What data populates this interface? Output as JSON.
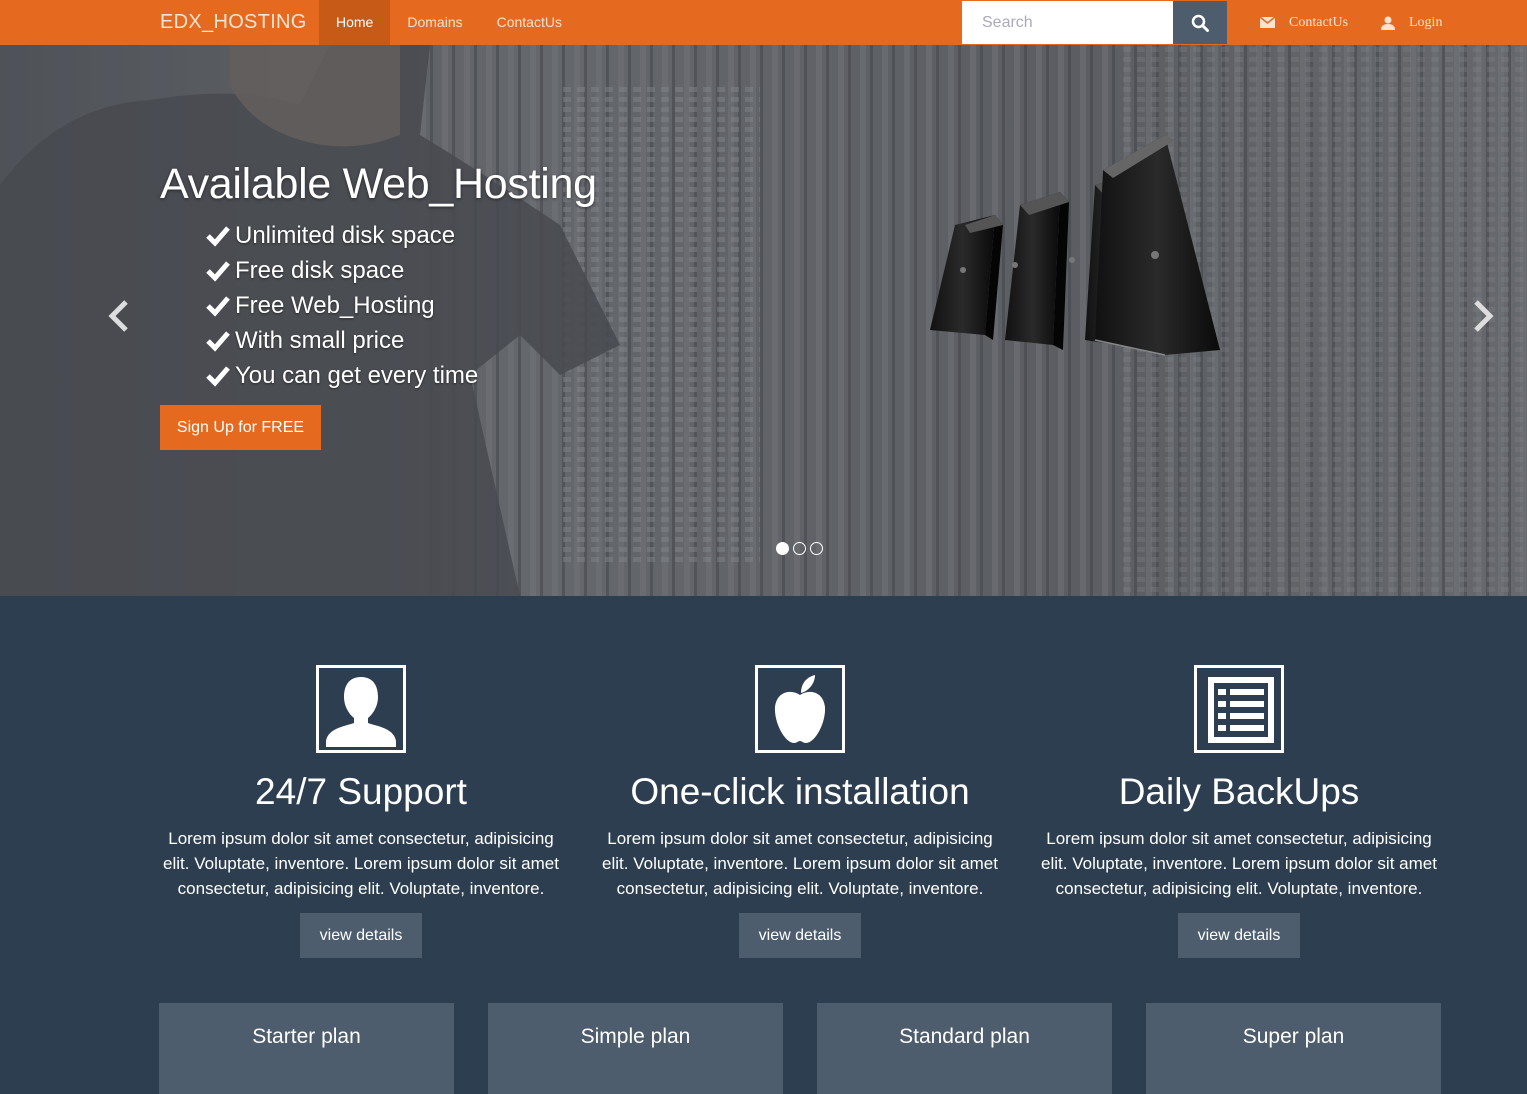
{
  "navbar": {
    "brand": "EDX_HOSTING",
    "items": [
      {
        "label": "Home",
        "active": true
      },
      {
        "label": "Domains",
        "active": false
      },
      {
        "label": "ContactUs",
        "active": false
      }
    ],
    "search_placeholder": "Search",
    "search_icon": "search-icon",
    "contact_label": "ContactUs",
    "contact_icon": "envelope-icon",
    "login_label": "Login",
    "login_icon": "user-icon",
    "color": "#e5691f"
  },
  "hero": {
    "title": "Available Web_Hosting",
    "features": [
      "Unlimited disk space",
      "Free disk space",
      "Free Web_Hosting",
      "With small price",
      "You can get every time"
    ],
    "cta_label": "Sign Up for FREE",
    "slide_count": 3,
    "active_slide": 1
  },
  "services": [
    {
      "icon": "user-icon",
      "title": "24/7 Support",
      "text": "Lorem ipsum dolor sit amet consectetur, adipisicing elit. Voluptate, inventore. Lorem ipsum dolor sit amet consectetur, adipisicing elit. Voluptate, inventore.",
      "button": "view details"
    },
    {
      "icon": "apple-icon",
      "title": "One-click installation",
      "text": "Lorem ipsum dolor sit amet consectetur, adipisicing elit. Voluptate, inventore. Lorem ipsum dolor sit amet consectetur, adipisicing elit. Voluptate, inventore.",
      "button": "view details"
    },
    {
      "icon": "list-icon",
      "title": "Daily BackUps",
      "text": "Lorem ipsum dolor sit amet consectetur, adipisicing elit. Voluptate, inventore. Lorem ipsum dolor sit amet consectetur, adipisicing elit. Voluptate, inventore.",
      "button": "view details"
    }
  ],
  "plans": [
    {
      "name": "Starter plan"
    },
    {
      "name": "Simple plan"
    },
    {
      "name": "Standard plan"
    },
    {
      "name": "Super plan"
    }
  ],
  "colors": {
    "accent": "#e5691f",
    "section_bg": "#2c3e50",
    "button_bg": "#4d5d6e"
  }
}
